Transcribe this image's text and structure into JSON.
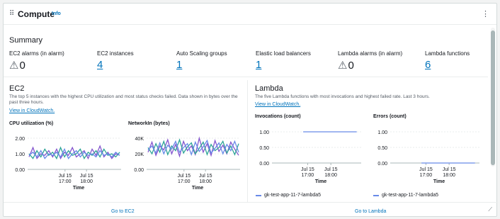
{
  "header": {
    "title": "Compute",
    "info": "Info"
  },
  "summary": {
    "title": "Summary",
    "metrics": [
      {
        "label": "EC2 alarms (in alarm)",
        "value": "0",
        "icon": "warning-icon"
      },
      {
        "label": "EC2 instances",
        "value": "4"
      },
      {
        "label": "Auto Scaling groups",
        "value": "1"
      },
      {
        "label": "Elastic load balancers",
        "value": "1"
      },
      {
        "label": "Lambda alarms (in alarm)",
        "value": "0",
        "icon": "warning-icon"
      },
      {
        "label": "Lambda functions",
        "value": "6"
      }
    ]
  },
  "ec2": {
    "title": "EC2",
    "description": "The top 5 instances with the highest CPU utilization and most status checks failed. Data shown in bytes over the past three hours.",
    "link": "View in CloudWatch.",
    "footer_link": "Go to EC2"
  },
  "lambda": {
    "title": "Lambda",
    "description": "The five Lambda functions with most invocations and highest failed rate. Last 3 hours.",
    "link": "View in CloudWatch.",
    "footer_link": "Go to Lambda"
  },
  "chart_data": [
    {
      "type": "line",
      "title": "CPU utilization (%)",
      "xlabel": "Time",
      "x_ticks": [
        "Jul 15\n17:00",
        "Jul 15\n18:00"
      ],
      "y_ticks": [
        "0.00",
        "1.00",
        "2.00"
      ],
      "ylim": [
        0,
        2
      ],
      "series": [
        {
          "values": [
            0.8,
            1.4,
            0.7,
            1.0,
            0.9,
            1.2,
            0.8,
            1.3,
            0.7,
            1.1,
            0.9,
            1.4,
            0.8,
            1.0,
            1.2,
            0.7,
            1.3,
            0.9,
            1.5,
            0.8,
            1.1,
            0.7,
            1.0,
            0.9
          ],
          "color": "#8456ce"
        },
        {
          "values": [
            1.0,
            0.7,
            1.2,
            0.8,
            1.3,
            0.9,
            1.1,
            0.7,
            1.4,
            0.8,
            1.2,
            0.9,
            1.0,
            1.3,
            0.7,
            1.1,
            0.9,
            1.2,
            0.8,
            1.3,
            0.9,
            1.0,
            0.8,
            1.1
          ],
          "color": "#2ea597"
        },
        {
          "values": [
            0.9,
            1.1,
            0.8,
            1.2,
            0.7,
            1.0,
            0.9,
            1.1,
            0.8,
            1.3,
            0.7,
            1.0,
            1.2,
            0.8,
            1.1,
            0.9,
            1.0,
            0.8,
            1.2,
            0.9,
            1.0,
            0.8,
            1.1,
            0.9
          ],
          "color": "#688ae8"
        }
      ]
    },
    {
      "type": "line",
      "title": "NetworkIn (bytes)",
      "xlabel": "Time",
      "x_ticks": [
        "Jul 15\n17:00",
        "Jul 15\n18:00"
      ],
      "y_ticks": [
        "0.00",
        "20K",
        "40K"
      ],
      "ylim": [
        0,
        40000
      ],
      "series": [
        {
          "values": [
            22000,
            35000,
            18000,
            30000,
            25000,
            38000,
            20000,
            32000,
            17000,
            36000,
            24000,
            30000,
            19000,
            40000,
            22000,
            33000,
            18000,
            37000,
            23000,
            31000,
            20000,
            35000,
            26000,
            18000
          ],
          "color": "#8456ce"
        },
        {
          "values": [
            28000,
            20000,
            33000,
            22000,
            36000,
            19000,
            30000,
            24000,
            38000,
            21000,
            29000,
            34000,
            20000,
            27000,
            35000,
            19000,
            32000,
            24000,
            28000,
            36000,
            21000,
            30000,
            19000,
            33000
          ],
          "color": "#2ea597"
        },
        {
          "values": [
            25000,
            30000,
            21000,
            34000,
            20000,
            31000,
            26000,
            36000,
            22000,
            28000,
            33000,
            19000,
            35000,
            23000,
            29000,
            37000,
            21000,
            27000,
            34000,
            20000,
            32000,
            24000,
            36000,
            22000
          ],
          "color": "#688ae8"
        }
      ]
    },
    {
      "type": "line",
      "title": "Invocations (count)",
      "xlabel": "Time",
      "x_ticks": [
        "Jul 15\n17:00",
        "Jul 15\n18:00"
      ],
      "y_ticks": [
        "0.00",
        "0.50",
        "1.00"
      ],
      "ylim": [
        0,
        1
      ],
      "series": [
        {
          "name": "gk-test-app-11-7-lambda5",
          "x_start": 0.35,
          "x_end": 0.95,
          "value": 1.0,
          "color": "#688ae8"
        }
      ]
    },
    {
      "type": "line",
      "title": "Errors (count)",
      "xlabel": "Time",
      "x_ticks": [
        "Jul 15\n17:00",
        "Jul 15\n18:00"
      ],
      "y_ticks": [
        "0.00",
        "0.50",
        "1.00"
      ],
      "ylim": [
        0,
        1
      ],
      "series": [
        {
          "name": "gk-test-app-11-7-lambda5",
          "x_start": 0.35,
          "x_end": 0.95,
          "value": 0.0,
          "color": "#688ae8"
        }
      ]
    }
  ]
}
